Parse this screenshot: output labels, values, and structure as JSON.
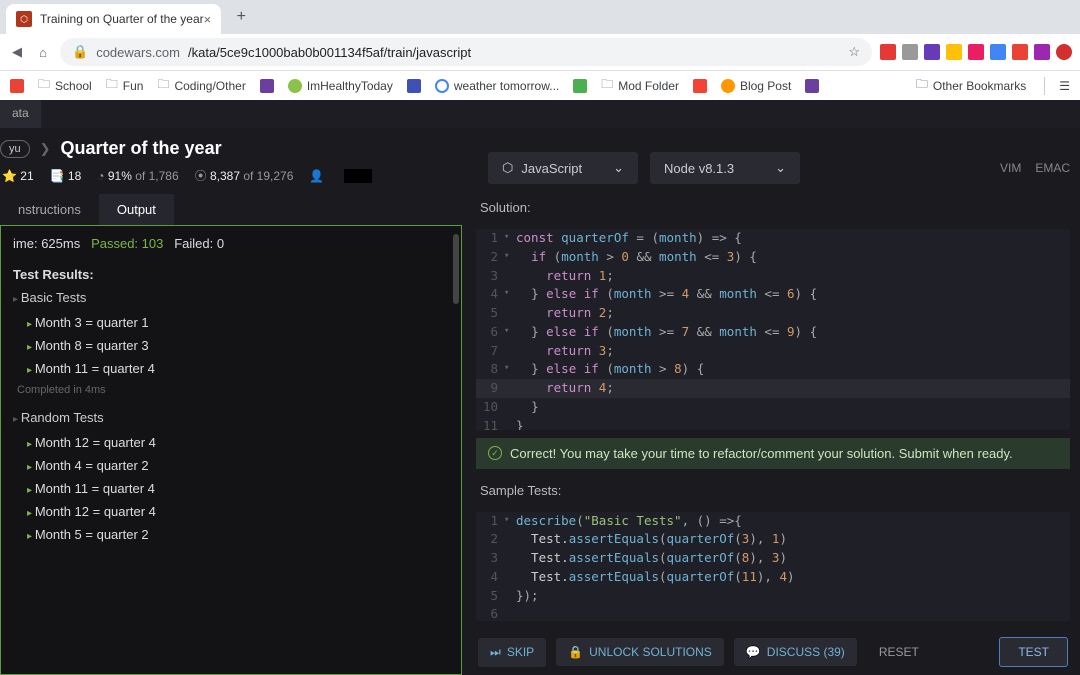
{
  "browser": {
    "tab_title": "Training on Quarter of the year",
    "url_host": "codewars.com",
    "url_path": "/kata/5ce9c1000bab0b001134f5af/train/javascript",
    "bookmarks": [
      "School",
      "Fun",
      "Coding/Other",
      "",
      "ImHealthyToday",
      "",
      "",
      "weather tomorrow...",
      "",
      "Mod Folder",
      "",
      "Blog Post",
      ""
    ],
    "other_bookmarks": "Other Bookmarks"
  },
  "topbar": {
    "item": "ata"
  },
  "kata": {
    "kyu": "yu",
    "title": "Quarter of the year",
    "stats": {
      "stars": "21",
      "collect": "18",
      "satisfaction_pct": "91%",
      "satisfaction_of": "of 1,786",
      "completed": "8,387",
      "completed_of": "of 19,276"
    }
  },
  "selectors": {
    "language": "JavaScript",
    "runtime": "Node v8.1.3"
  },
  "editor_modes": {
    "vim": "VIM",
    "emacs": "EMAC"
  },
  "left_tabs": {
    "instructions": "nstructions",
    "output": "Output"
  },
  "output": {
    "time_label": "ime:",
    "time": "625ms",
    "passed_label": "Passed:",
    "passed": "103",
    "failed_label": "Failed:",
    "failed": "0",
    "results_label": "Test Results:",
    "basic_label": "Basic Tests",
    "basic_tests": [
      "Month 3 = quarter 1",
      "Month 8 = quarter 3",
      "Month 11 = quarter 4"
    ],
    "completed_in": "Completed in 4ms",
    "random_label": "Random Tests",
    "random_tests": [
      "Month 12 = quarter 4",
      "Month 4 = quarter 2",
      "Month 11 = quarter 4",
      "Month 12 = quarter 4",
      "Month 5 = quarter 2"
    ]
  },
  "solution": {
    "heading": "Solution:",
    "lines": [
      {
        "n": "1",
        "fold": "▾",
        "tokens": [
          [
            "tk-keyword",
            "const "
          ],
          [
            "tk-name",
            "quarterOf"
          ],
          [
            "tk-op",
            " = ("
          ],
          [
            "tk-name",
            "month"
          ],
          [
            "tk-op",
            ") "
          ],
          [
            "tk-op",
            "=>"
          ],
          [
            "tk-brace",
            " {"
          ]
        ]
      },
      {
        "n": "2",
        "fold": "▾",
        "tokens": [
          [
            "tk-plain",
            "  "
          ],
          [
            "tk-keyword",
            "if"
          ],
          [
            "tk-op",
            " ("
          ],
          [
            "tk-name",
            "month"
          ],
          [
            "tk-op",
            " > "
          ],
          [
            "tk-num",
            "0"
          ],
          [
            "tk-op",
            " && "
          ],
          [
            "tk-name",
            "month"
          ],
          [
            "tk-op",
            " <= "
          ],
          [
            "tk-num",
            "3"
          ],
          [
            "tk-op",
            ") "
          ],
          [
            "tk-brace",
            "{"
          ]
        ]
      },
      {
        "n": "3",
        "fold": "",
        "tokens": [
          [
            "tk-plain",
            "    "
          ],
          [
            "tk-keyword",
            "return "
          ],
          [
            "tk-num",
            "1"
          ],
          [
            "tk-op",
            ";"
          ]
        ]
      },
      {
        "n": "4",
        "fold": "▾",
        "tokens": [
          [
            "tk-plain",
            "  "
          ],
          [
            "tk-brace",
            "}"
          ],
          [
            "tk-keyword",
            " else if"
          ],
          [
            "tk-op",
            " ("
          ],
          [
            "tk-name",
            "month"
          ],
          [
            "tk-op",
            " >= "
          ],
          [
            "tk-num",
            "4"
          ],
          [
            "tk-op",
            " && "
          ],
          [
            "tk-name",
            "month"
          ],
          [
            "tk-op",
            " <= "
          ],
          [
            "tk-num",
            "6"
          ],
          [
            "tk-op",
            ") "
          ],
          [
            "tk-brace",
            "{"
          ]
        ]
      },
      {
        "n": "5",
        "fold": "",
        "tokens": [
          [
            "tk-plain",
            "    "
          ],
          [
            "tk-keyword",
            "return "
          ],
          [
            "tk-num",
            "2"
          ],
          [
            "tk-op",
            ";"
          ]
        ]
      },
      {
        "n": "6",
        "fold": "▾",
        "tokens": [
          [
            "tk-plain",
            "  "
          ],
          [
            "tk-brace",
            "}"
          ],
          [
            "tk-keyword",
            " else if"
          ],
          [
            "tk-op",
            " ("
          ],
          [
            "tk-name",
            "month"
          ],
          [
            "tk-op",
            " >= "
          ],
          [
            "tk-num",
            "7"
          ],
          [
            "tk-op",
            " && "
          ],
          [
            "tk-name",
            "month"
          ],
          [
            "tk-op",
            " <= "
          ],
          [
            "tk-num",
            "9"
          ],
          [
            "tk-op",
            ") "
          ],
          [
            "tk-brace",
            "{"
          ]
        ]
      },
      {
        "n": "7",
        "fold": "",
        "tokens": [
          [
            "tk-plain",
            "    "
          ],
          [
            "tk-keyword",
            "return "
          ],
          [
            "tk-num",
            "3"
          ],
          [
            "tk-op",
            ";"
          ]
        ]
      },
      {
        "n": "8",
        "fold": "▾",
        "tokens": [
          [
            "tk-plain",
            "  "
          ],
          [
            "tk-brace",
            "}"
          ],
          [
            "tk-keyword",
            " else if"
          ],
          [
            "tk-op",
            " ("
          ],
          [
            "tk-name",
            "month"
          ],
          [
            "tk-op",
            " > "
          ],
          [
            "tk-num",
            "8"
          ],
          [
            "tk-op",
            ") "
          ],
          [
            "tk-brace",
            "{"
          ]
        ]
      },
      {
        "n": "9",
        "fold": "",
        "hl": true,
        "tokens": [
          [
            "tk-plain",
            "    "
          ],
          [
            "tk-keyword",
            "return "
          ],
          [
            "tk-num",
            "4"
          ],
          [
            "tk-op",
            ";"
          ]
        ]
      },
      {
        "n": "10",
        "fold": "",
        "tokens": [
          [
            "tk-plain",
            "  "
          ],
          [
            "tk-brace",
            "}"
          ]
        ]
      },
      {
        "n": "11",
        "fold": "",
        "tokens": [
          [
            "tk-brace",
            "}"
          ]
        ]
      }
    ]
  },
  "status": {
    "msg": "Correct! You may take your time to refactor/comment your solution. Submit when ready."
  },
  "sample": {
    "heading": "Sample Tests:",
    "lines": [
      {
        "n": "1",
        "fold": "▾",
        "tokens": [
          [
            "tk-name",
            "describe"
          ],
          [
            "tk-op",
            "("
          ],
          [
            "tk-string",
            "\"Basic Tests\""
          ],
          [
            "tk-op",
            ", () "
          ],
          [
            "tk-op",
            "=>"
          ],
          [
            "tk-brace",
            "{"
          ]
        ]
      },
      {
        "n": "2",
        "fold": "",
        "tokens": [
          [
            "tk-plain",
            "  Test."
          ],
          [
            "tk-method",
            "assertEquals"
          ],
          [
            "tk-op",
            "("
          ],
          [
            "tk-name",
            "quarterOf"
          ],
          [
            "tk-op",
            "("
          ],
          [
            "tk-num",
            "3"
          ],
          [
            "tk-op",
            "), "
          ],
          [
            "tk-num",
            "1"
          ],
          [
            "tk-op",
            ")"
          ]
        ]
      },
      {
        "n": "3",
        "fold": "",
        "tokens": [
          [
            "tk-plain",
            "  Test."
          ],
          [
            "tk-method",
            "assertEquals"
          ],
          [
            "tk-op",
            "("
          ],
          [
            "tk-name",
            "quarterOf"
          ],
          [
            "tk-op",
            "("
          ],
          [
            "tk-num",
            "8"
          ],
          [
            "tk-op",
            "), "
          ],
          [
            "tk-num",
            "3"
          ],
          [
            "tk-op",
            ")"
          ]
        ]
      },
      {
        "n": "4",
        "fold": "",
        "tokens": [
          [
            "tk-plain",
            "  Test."
          ],
          [
            "tk-method",
            "assertEquals"
          ],
          [
            "tk-op",
            "("
          ],
          [
            "tk-name",
            "quarterOf"
          ],
          [
            "tk-op",
            "("
          ],
          [
            "tk-num",
            "11"
          ],
          [
            "tk-op",
            "), "
          ],
          [
            "tk-num",
            "4"
          ],
          [
            "tk-op",
            ")"
          ]
        ]
      },
      {
        "n": "5",
        "fold": "",
        "tokens": [
          [
            "tk-op",
            "});"
          ]
        ]
      },
      {
        "n": "6",
        "fold": "",
        "tokens": [
          [
            "tk-plain",
            ""
          ]
        ]
      }
    ]
  },
  "actions": {
    "skip": "SKIP",
    "unlock": "UNLOCK SOLUTIONS",
    "discuss": "DISCUSS (39)",
    "reset": "RESET",
    "test": "TEST"
  }
}
